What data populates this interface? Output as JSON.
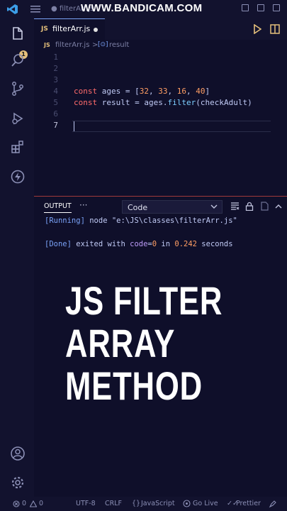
{
  "titlebar": {
    "title": "● filterArr.js",
    "watermark": "WWW.BANDICAM.COM"
  },
  "activity": {
    "badge_count": "1",
    "icons": [
      "files-icon",
      "search-icon",
      "source-control-icon",
      "run-debug-icon",
      "extensions-icon",
      "thunder-icon",
      "account-icon",
      "settings-gear-icon"
    ]
  },
  "tab": {
    "lang_badge": "JS",
    "filename": "filterArr.js"
  },
  "breadcrumb": {
    "lang_badge": "JS",
    "file": "filterArr.js",
    "separator": ">",
    "symbol_icon": "[⊙]",
    "symbol": "result"
  },
  "editor": {
    "line_numbers": [
      "1",
      "2",
      "3",
      "4",
      "5",
      "6",
      "7"
    ],
    "line4": {
      "kw": "const",
      "name": " ages = [",
      "n1": "32",
      "c1": ", ",
      "n2": "33",
      "c2": ", ",
      "n3": "16",
      "c3": ", ",
      "n4": "40",
      "end": "]"
    },
    "line5": {
      "kw": "const",
      "pre": " result = ages.",
      "fn": "filter",
      "post": "(checkAdult)"
    }
  },
  "panel": {
    "tab_label": "OUTPUT",
    "more": "···",
    "dropdown_value": "Code"
  },
  "output": {
    "line1_tag": "[Running]",
    "line1_text": " node \"e:\\JS\\classes\\filterArr.js\"",
    "line2_tag": "[Done]",
    "line2_pre": " exited with ",
    "line2_code_kw": "code",
    "line2_eq": "=",
    "line2_code_val": "0",
    "line2_in": " in ",
    "line2_time": "0.242",
    "line2_unit": " seconds"
  },
  "overlay": {
    "line1": "JS FILTER",
    "line2": "ARRAY",
    "line3": "METHOD"
  },
  "statusbar": {
    "errors": "0",
    "warnings": "0",
    "encoding": "UTF-8",
    "eol": "CRLF",
    "language": "JavaScript",
    "golive": "Go Live",
    "prettier": "Prettier"
  },
  "colors": {
    "background": "#0f0f2a",
    "chrome": "#12122e",
    "keyword": "#ff6b6b",
    "number": "#ff9e64",
    "accent": "#7aa2f7"
  }
}
